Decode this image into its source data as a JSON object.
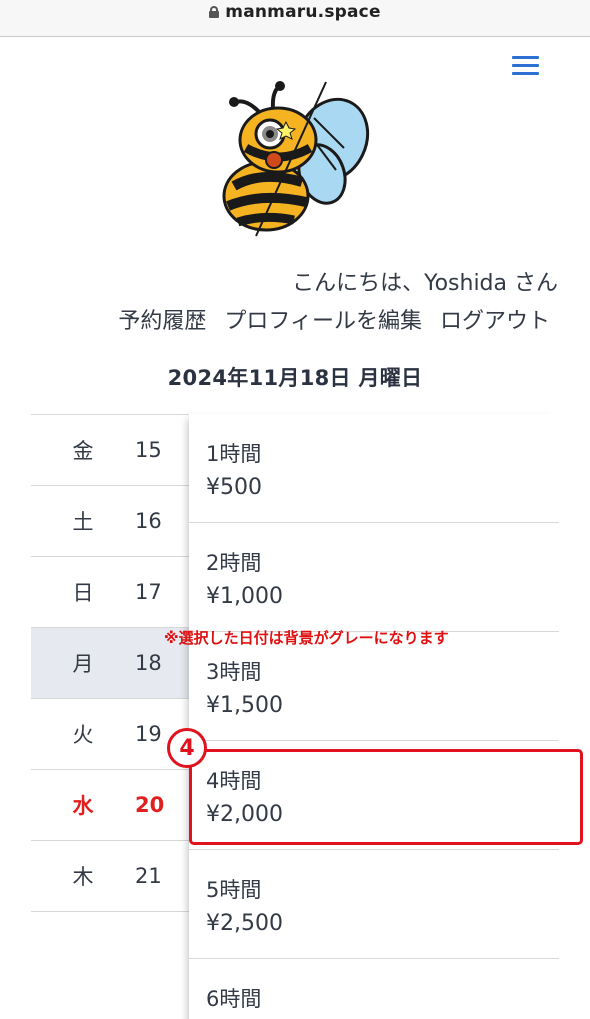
{
  "browser": {
    "url": "manmaru.space"
  },
  "header": {
    "greeting": "こんにちは、Yoshida さん",
    "nav": [
      {
        "label": "予約履歴"
      },
      {
        "label": "プロフィールを編集"
      },
      {
        "label": "ログアウト"
      }
    ]
  },
  "date_title": "2024年11月18日 月曜日",
  "days": [
    {
      "weekday": "金",
      "date": "15",
      "selected": false,
      "red": false
    },
    {
      "weekday": "土",
      "date": "16",
      "selected": false,
      "red": false
    },
    {
      "weekday": "日",
      "date": "17",
      "selected": false,
      "red": false
    },
    {
      "weekday": "月",
      "date": "18",
      "selected": true,
      "red": false
    },
    {
      "weekday": "火",
      "date": "19",
      "selected": false,
      "red": false
    },
    {
      "weekday": "水",
      "date": "20",
      "selected": false,
      "red": true
    },
    {
      "weekday": "木",
      "date": "21",
      "selected": false,
      "red": false
    }
  ],
  "slots": [
    {
      "duration": "1時間",
      "price": "¥500"
    },
    {
      "duration": "2時間",
      "price": "¥1,000"
    },
    {
      "duration": "3時間",
      "price": "¥1,500"
    },
    {
      "duration": "4時間",
      "price": "¥2,000"
    },
    {
      "duration": "5時間",
      "price": "¥2,500"
    },
    {
      "duration": "6時間",
      "price": ""
    }
  ],
  "annotation": {
    "note": "※選択した日付は背景がグレーになります",
    "step": "4"
  },
  "colors": {
    "accent_blue": "#2a6fd1",
    "annotation_red": "#e0121e",
    "selected_bg": "#e6e9ef",
    "text": "#333a45"
  }
}
